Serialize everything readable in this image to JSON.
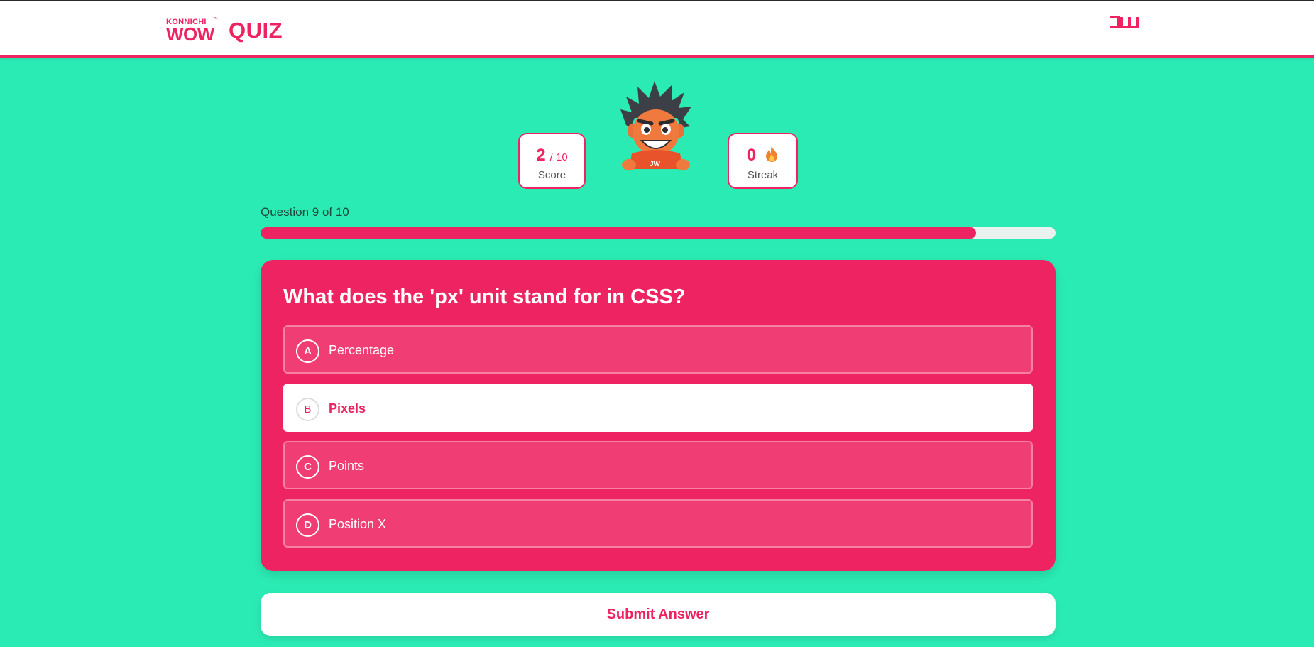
{
  "header": {
    "logo_small": "KONNICHI",
    "logo_big": "WOW",
    "logo_tm": "™",
    "title": "QUIZ"
  },
  "stats": {
    "score": "2",
    "score_total": "/ 10",
    "score_label": "Score",
    "streak": "0",
    "streak_label": "Streak"
  },
  "progress": {
    "counter": "Question 9 of 10",
    "fraction": 0.9
  },
  "question": {
    "text": "What does the 'px' unit stand for in CSS?",
    "options": [
      {
        "letter": "A",
        "label": "Percentage",
        "selected": false
      },
      {
        "letter": "B",
        "label": "Pixels",
        "selected": true
      },
      {
        "letter": "C",
        "label": "Points",
        "selected": false
      },
      {
        "letter": "D",
        "label": "Position X",
        "selected": false
      }
    ]
  },
  "submit_label": "Submit Answer",
  "icons": {
    "streak": "flame-icon",
    "mascot": "mascot-character",
    "brand": "jw-logo"
  },
  "colors": {
    "accent": "#EE2462",
    "background": "#2BEBB4"
  }
}
